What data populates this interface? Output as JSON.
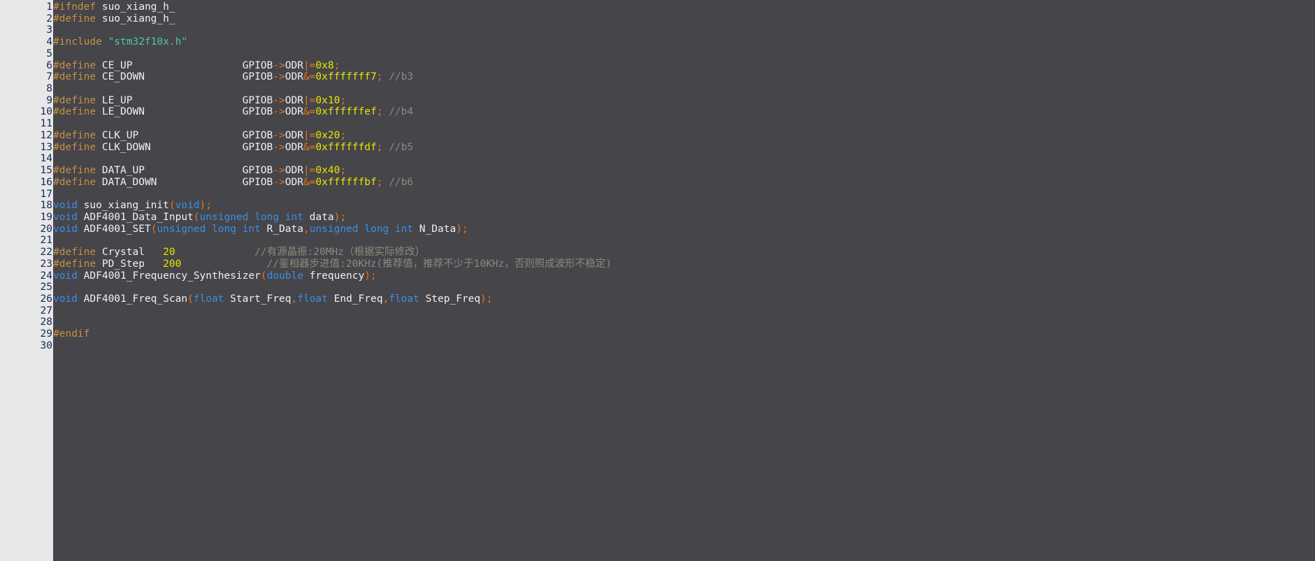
{
  "editor": {
    "background_color": "#45454a",
    "gutter_background_color": "#e7e7e7",
    "gutter_number_color": "#13285e",
    "total_lines": 30
  },
  "theme": {
    "preprocessor_color": "#c79040",
    "identifier_color": "#f2f2f2",
    "string_color": "#4ec9a0",
    "keyword_color": "#3d8fe0",
    "punctuation_color": "#e8761c",
    "number_color": "#e6e600",
    "comment_color": "#8b8b7e"
  },
  "line_numbers": [
    "1",
    "2",
    "3",
    "4",
    "5",
    "6",
    "7",
    "8",
    "9",
    "10",
    "11",
    "12",
    "13",
    "14",
    "15",
    "16",
    "17",
    "18",
    "19",
    "20",
    "21",
    "22",
    "23",
    "24",
    "25",
    "26",
    "27",
    "28",
    "29",
    "30"
  ],
  "code_lines": [
    {
      "number": "1",
      "tokens": [
        {
          "c": "t-pre",
          "t": "#ifndef"
        },
        {
          "c": "t-id",
          "t": " suo_xiang_h_"
        }
      ]
    },
    {
      "number": "2",
      "tokens": [
        {
          "c": "t-pre",
          "t": "#define"
        },
        {
          "c": "t-id",
          "t": " suo_xiang_h_"
        }
      ]
    },
    {
      "number": "3",
      "tokens": []
    },
    {
      "number": "4",
      "tokens": [
        {
          "c": "t-pre",
          "t": "#include"
        },
        {
          "c": "t-id",
          "t": " "
        },
        {
          "c": "t-str",
          "t": "\"stm32f10x.h\""
        }
      ]
    },
    {
      "number": "5",
      "tokens": []
    },
    {
      "number": "6",
      "tokens": [
        {
          "c": "t-pre",
          "t": "#define"
        },
        {
          "c": "t-id",
          "t": " CE_UP                  GPIOB"
        },
        {
          "c": "t-punc",
          "t": "->"
        },
        {
          "c": "t-id",
          "t": "ODR"
        },
        {
          "c": "t-punc",
          "t": "|="
        },
        {
          "c": "t-num",
          "t": "0x8"
        },
        {
          "c": "t-punc",
          "t": ";"
        }
      ]
    },
    {
      "number": "7",
      "tokens": [
        {
          "c": "t-pre",
          "t": "#define"
        },
        {
          "c": "t-id",
          "t": " CE_DOWN                GPIOB"
        },
        {
          "c": "t-punc",
          "t": "->"
        },
        {
          "c": "t-id",
          "t": "ODR"
        },
        {
          "c": "t-punc",
          "t": "&="
        },
        {
          "c": "t-num",
          "t": "0xfffffff7"
        },
        {
          "c": "t-punc",
          "t": ";"
        },
        {
          "c": "t-cmt",
          "t": " //b3"
        }
      ]
    },
    {
      "number": "8",
      "tokens": []
    },
    {
      "number": "9",
      "tokens": [
        {
          "c": "t-pre",
          "t": "#define"
        },
        {
          "c": "t-id",
          "t": " LE_UP                  GPIOB"
        },
        {
          "c": "t-punc",
          "t": "->"
        },
        {
          "c": "t-id",
          "t": "ODR"
        },
        {
          "c": "t-punc",
          "t": "|="
        },
        {
          "c": "t-num",
          "t": "0x10"
        },
        {
          "c": "t-punc",
          "t": ";"
        }
      ]
    },
    {
      "number": "10",
      "tokens": [
        {
          "c": "t-pre",
          "t": "#define"
        },
        {
          "c": "t-id",
          "t": " LE_DOWN                GPIOB"
        },
        {
          "c": "t-punc",
          "t": "->"
        },
        {
          "c": "t-id",
          "t": "ODR"
        },
        {
          "c": "t-punc",
          "t": "&="
        },
        {
          "c": "t-num",
          "t": "0xffffffef"
        },
        {
          "c": "t-punc",
          "t": ";"
        },
        {
          "c": "t-cmt",
          "t": " //b4"
        }
      ]
    },
    {
      "number": "11",
      "tokens": []
    },
    {
      "number": "12",
      "tokens": [
        {
          "c": "t-pre",
          "t": "#define"
        },
        {
          "c": "t-id",
          "t": " CLK_UP                 GPIOB"
        },
        {
          "c": "t-punc",
          "t": "->"
        },
        {
          "c": "t-id",
          "t": "ODR"
        },
        {
          "c": "t-punc",
          "t": "|="
        },
        {
          "c": "t-num",
          "t": "0x20"
        },
        {
          "c": "t-punc",
          "t": ";"
        }
      ]
    },
    {
      "number": "13",
      "tokens": [
        {
          "c": "t-pre",
          "t": "#define"
        },
        {
          "c": "t-id",
          "t": " CLK_DOWN               GPIOB"
        },
        {
          "c": "t-punc",
          "t": "->"
        },
        {
          "c": "t-id",
          "t": "ODR"
        },
        {
          "c": "t-punc",
          "t": "&="
        },
        {
          "c": "t-num",
          "t": "0xffffffdf"
        },
        {
          "c": "t-punc",
          "t": ";"
        },
        {
          "c": "t-cmt",
          "t": " //b5"
        }
      ]
    },
    {
      "number": "14",
      "tokens": []
    },
    {
      "number": "15",
      "tokens": [
        {
          "c": "t-pre",
          "t": "#define"
        },
        {
          "c": "t-id",
          "t": " DATA_UP                GPIOB"
        },
        {
          "c": "t-punc",
          "t": "->"
        },
        {
          "c": "t-id",
          "t": "ODR"
        },
        {
          "c": "t-punc",
          "t": "|="
        },
        {
          "c": "t-num",
          "t": "0x40"
        },
        {
          "c": "t-punc",
          "t": ";"
        }
      ]
    },
    {
      "number": "16",
      "tokens": [
        {
          "c": "t-pre",
          "t": "#define"
        },
        {
          "c": "t-id",
          "t": " DATA_DOWN              GPIOB"
        },
        {
          "c": "t-punc",
          "t": "->"
        },
        {
          "c": "t-id",
          "t": "ODR"
        },
        {
          "c": "t-punc",
          "t": "&="
        },
        {
          "c": "t-num",
          "t": "0xffffffbf"
        },
        {
          "c": "t-punc",
          "t": ";"
        },
        {
          "c": "t-cmt",
          "t": " //b6"
        }
      ]
    },
    {
      "number": "17",
      "tokens": []
    },
    {
      "number": "18",
      "tokens": [
        {
          "c": "t-kw",
          "t": "void"
        },
        {
          "c": "t-id",
          "t": " suo_xiang_init"
        },
        {
          "c": "t-punc",
          "t": "("
        },
        {
          "c": "t-kw",
          "t": "void"
        },
        {
          "c": "t-punc",
          "t": ");"
        }
      ]
    },
    {
      "number": "19",
      "tokens": [
        {
          "c": "t-kw",
          "t": "void"
        },
        {
          "c": "t-id",
          "t": " ADF4001_Data_Input"
        },
        {
          "c": "t-punc",
          "t": "("
        },
        {
          "c": "t-kw",
          "t": "unsigned long int"
        },
        {
          "c": "t-id",
          "t": " data"
        },
        {
          "c": "t-punc",
          "t": ");"
        }
      ]
    },
    {
      "number": "20",
      "tokens": [
        {
          "c": "t-kw",
          "t": "void"
        },
        {
          "c": "t-id",
          "t": " ADF4001_SET"
        },
        {
          "c": "t-punc",
          "t": "("
        },
        {
          "c": "t-kw",
          "t": "unsigned long int"
        },
        {
          "c": "t-id",
          "t": " R_Data"
        },
        {
          "c": "t-punc",
          "t": ","
        },
        {
          "c": "t-kw",
          "t": "unsigned long int"
        },
        {
          "c": "t-id",
          "t": " N_Data"
        },
        {
          "c": "t-punc",
          "t": ");"
        }
      ]
    },
    {
      "number": "21",
      "tokens": []
    },
    {
      "number": "22",
      "tokens": [
        {
          "c": "t-pre",
          "t": "#define"
        },
        {
          "c": "t-id",
          "t": " Crystal   "
        },
        {
          "c": "t-num",
          "t": "20"
        },
        {
          "c": "t-id",
          "t": "             "
        },
        {
          "c": "t-cmt",
          "t": "//有源晶振:20MHz（根据实际修改）"
        }
      ]
    },
    {
      "number": "23",
      "tokens": [
        {
          "c": "t-pre",
          "t": "#define"
        },
        {
          "c": "t-id",
          "t": " PD_Step   "
        },
        {
          "c": "t-num",
          "t": "200"
        },
        {
          "c": "t-id",
          "t": "              "
        },
        {
          "c": "t-cmt",
          "t": "//鉴相器步进值:20KHz(推荐值，推荐不少于10KHz，否则照成波形不稳定)"
        }
      ]
    },
    {
      "number": "24",
      "tokens": [
        {
          "c": "t-kw",
          "t": "void"
        },
        {
          "c": "t-id",
          "t": " ADF4001_Frequency_Synthesizer"
        },
        {
          "c": "t-punc",
          "t": "("
        },
        {
          "c": "t-kw",
          "t": "double"
        },
        {
          "c": "t-id",
          "t": " frequency"
        },
        {
          "c": "t-punc",
          "t": ");"
        }
      ]
    },
    {
      "number": "25",
      "tokens": []
    },
    {
      "number": "26",
      "tokens": [
        {
          "c": "t-kw",
          "t": "void"
        },
        {
          "c": "t-id",
          "t": " ADF4001_Freq_Scan"
        },
        {
          "c": "t-punc",
          "t": "("
        },
        {
          "c": "t-kw",
          "t": "float"
        },
        {
          "c": "t-id",
          "t": " Start_Freq"
        },
        {
          "c": "t-punc",
          "t": ","
        },
        {
          "c": "t-kw",
          "t": "float"
        },
        {
          "c": "t-id",
          "t": " End_Freq"
        },
        {
          "c": "t-punc",
          "t": ","
        },
        {
          "c": "t-kw",
          "t": "float"
        },
        {
          "c": "t-id",
          "t": " Step_Freq"
        },
        {
          "c": "t-punc",
          "t": ");"
        }
      ]
    },
    {
      "number": "27",
      "tokens": []
    },
    {
      "number": "28",
      "tokens": []
    },
    {
      "number": "29",
      "tokens": [
        {
          "c": "t-pre",
          "t": "#endif"
        }
      ]
    },
    {
      "number": "30",
      "tokens": []
    }
  ]
}
